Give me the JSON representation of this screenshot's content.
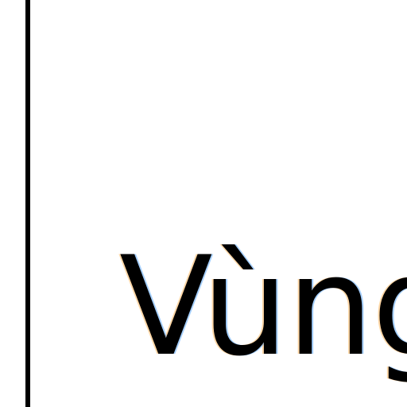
{
  "cell": {
    "label": "Vùng"
  },
  "colors": {
    "background": "#ffffff",
    "border": "#000000",
    "text": "#000000"
  }
}
